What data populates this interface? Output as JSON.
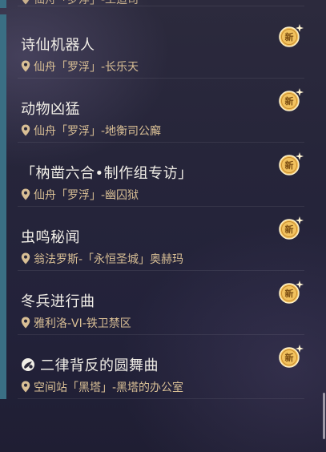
{
  "partial_item": {
    "location": "仙舟「罗浮」-工造司"
  },
  "quests": [
    {
      "title": "诗仙机器人",
      "location": "仙舟「罗浮」-长乐天",
      "badge": "新",
      "has_icon": false
    },
    {
      "title": "动物凶猛",
      "location": "仙舟「罗浮」-地衡司公廨",
      "badge": "新",
      "has_icon": false
    },
    {
      "title": "「枘凿六合•制作组专访」",
      "location": "仙舟「罗浮」-幽囚狱",
      "badge": "新",
      "has_icon": false
    },
    {
      "title": "虫鸣秘闻",
      "location": "翁法罗斯-「永恒圣城」奥赫玛",
      "badge": "新",
      "has_icon": false
    },
    {
      "title": "冬兵进行曲",
      "location": "雅利洛-VI-铁卫禁区",
      "badge": "新",
      "has_icon": false
    },
    {
      "title": "二律背反的圆舞曲",
      "location": "空间站「黑塔」-黑塔的办公室",
      "badge": "新",
      "has_icon": true,
      "icon": "quest-mission-icon"
    }
  ],
  "colors": {
    "accent_bar": "#3a6f84",
    "title_text": "#f1eee7",
    "location_text": "#d9bf95",
    "badge_gold": "#f2c25e"
  }
}
